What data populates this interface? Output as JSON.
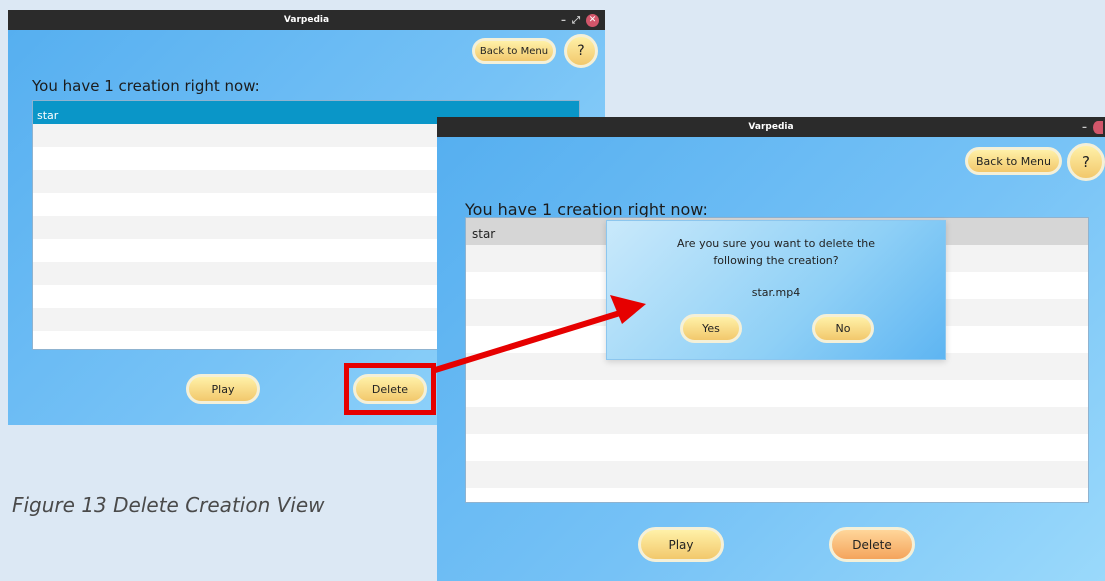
{
  "caption": "Figure 13 Delete Creation View",
  "window_left": {
    "title": "Varpedia",
    "controls": {
      "minimize": "–",
      "maximize": "⤢",
      "close": "✕"
    },
    "back_to_menu": "Back to Menu",
    "help": "?",
    "heading": "You have 1 creation right now:",
    "creations": [
      "star"
    ],
    "play": "Play",
    "delete": "Delete"
  },
  "window_right": {
    "title": "Varpedia",
    "controls": {
      "minimize": "–"
    },
    "back_to_menu": "Back to Menu",
    "help": "?",
    "heading": "You have 1 creation right now:",
    "creations": [
      "star"
    ],
    "play": "Play",
    "delete": "Delete"
  },
  "dialog": {
    "message_line1": "Are you sure you want to delete the",
    "message_line2": "following the creation?",
    "filename": "star.mp4",
    "yes": "Yes",
    "no": "No"
  },
  "colors": {
    "highlight_box": "#e60000",
    "arrow": "#e60000",
    "selected_row": "#0a96c8",
    "button_yellow": "#f2c86c",
    "button_orange": "#f4a45c"
  }
}
